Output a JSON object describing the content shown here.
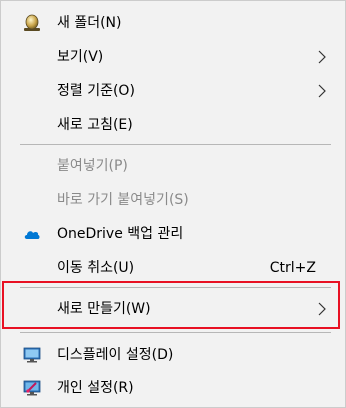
{
  "colors": {
    "menu_background": "#f2f2f2",
    "disabled_text": "#8a8a8a",
    "separator": "#b7b7b7",
    "highlight_border": "#e81123",
    "onedrive_blue": "#0078d4"
  },
  "menu": {
    "new_folder": {
      "label": "새 폴더(N)",
      "icon": "new-folder-icon"
    },
    "view": {
      "label": "보기(V)",
      "icon": "chevron-right-icon"
    },
    "sort_by": {
      "label": "정렬 기준(O)",
      "icon": "chevron-right-icon"
    },
    "refresh": {
      "label": "새로 고침(E)"
    },
    "paste": {
      "label": "붙여넣기(P)",
      "enabled": false
    },
    "paste_shortcut": {
      "label": "바로 가기 붙여넣기(S)",
      "enabled": false
    },
    "onedrive_backup": {
      "label": "OneDrive 백업 관리",
      "icon": "onedrive-cloud-icon"
    },
    "undo_move": {
      "label": "이동 취소(U)",
      "shortcut": "Ctrl+Z"
    },
    "new": {
      "label": "새로 만들기(W)",
      "icon": "chevron-right-icon",
      "highlighted": true
    },
    "display_settings": {
      "label": "디스플레이 설정(D)",
      "icon": "monitor-icon"
    },
    "personalize": {
      "label": "개인 설정(R)",
      "icon": "personalize-icon"
    }
  }
}
